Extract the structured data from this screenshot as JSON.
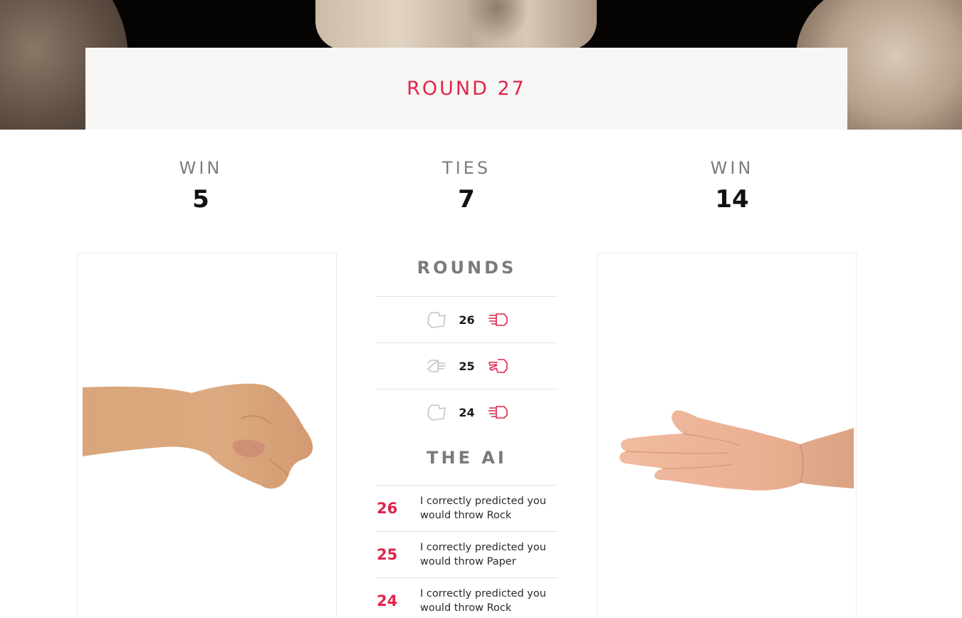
{
  "header": {
    "round_label": "ROUND 27"
  },
  "scores": {
    "player": {
      "label": "WIN",
      "value": "5"
    },
    "ties": {
      "label": "TIES",
      "value": "7"
    },
    "ai": {
      "label": "WIN",
      "value": "14"
    }
  },
  "player_hand": {
    "throw": "Rock",
    "image": "fist-photo"
  },
  "ai_hand": {
    "throw": "Paper",
    "image": "open-palm-photo"
  },
  "rounds": {
    "title": "ROUNDS",
    "items": [
      {
        "number": "26",
        "player_throw": "rock",
        "player_icon": "rock-hand-icon",
        "ai_throw": "paper",
        "ai_icon": "paper-hand-icon"
      },
      {
        "number": "25",
        "player_throw": "paper",
        "player_icon": "paper-hand-icon",
        "ai_throw": "scissors",
        "ai_icon": "scissors-hand-icon"
      },
      {
        "number": "24",
        "player_throw": "rock",
        "player_icon": "rock-hand-icon",
        "ai_throw": "paper",
        "ai_icon": "paper-hand-icon"
      }
    ]
  },
  "ai_log": {
    "title": "THE AI",
    "items": [
      {
        "number": "26",
        "message": "I correctly predicted you would throw Rock"
      },
      {
        "number": "25",
        "message": "I correctly predicted you would throw Paper"
      },
      {
        "number": "24",
        "message": "I correctly predicted you would throw Rock"
      }
    ]
  },
  "colors": {
    "accent": "#e0244a",
    "muted_icon": "#c4c4c4",
    "label_gray": "#7d7d7d",
    "card_bg": "#f9f7f6"
  }
}
